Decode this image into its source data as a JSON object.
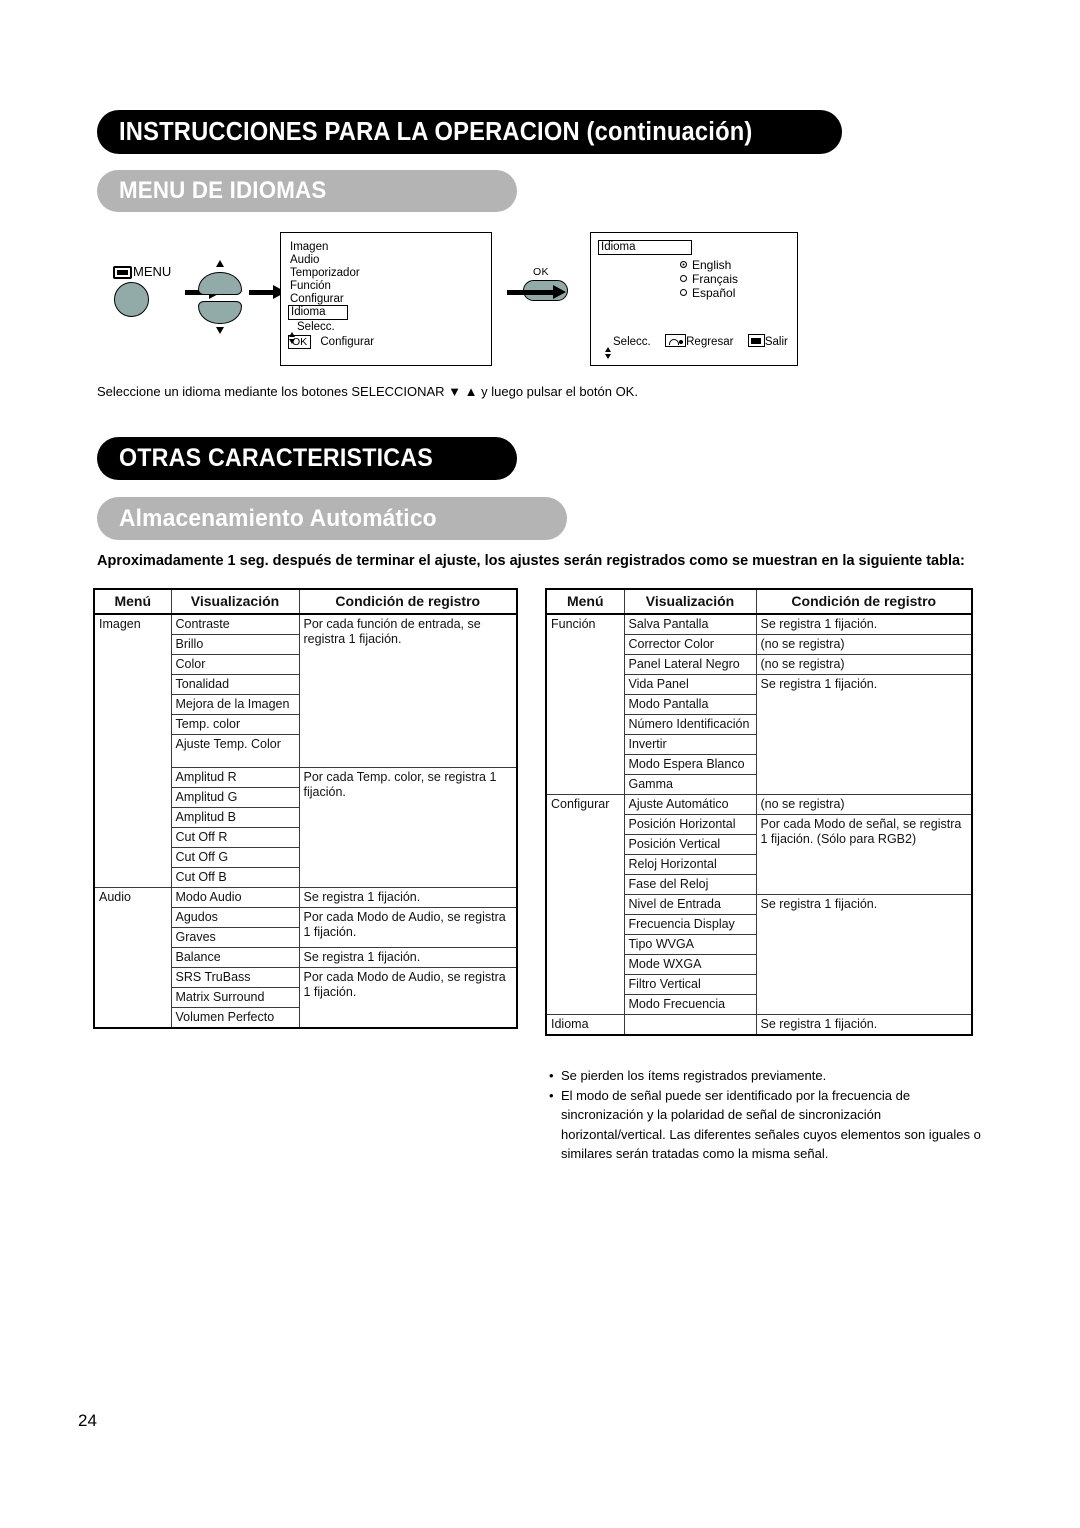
{
  "headings": {
    "main": "INSTRUCCIONES PARA LA OPERACION (continuación)",
    "language_menu": "MENU DE IDIOMAS",
    "other_features": "OTRAS CARACTERISTICAS",
    "auto_storage": "Almacenamiento Automático"
  },
  "diagram": {
    "menu_button_label": "MENU",
    "ok_button_label": "OK",
    "main_menu": {
      "items": [
        "Imagen",
        "Audio",
        "Temporizador",
        "Función",
        "Configurar"
      ],
      "selected_item": "Idioma",
      "hint_select": "Selecc.",
      "hint_ok_key": "OK",
      "hint_ok_action": "Configurar"
    },
    "language_menu": {
      "title": "Idioma",
      "options": [
        {
          "label": "English",
          "selected": true
        },
        {
          "label": "Français",
          "selected": false
        },
        {
          "label": "Español",
          "selected": false
        }
      ],
      "hint_select": "Selecc.",
      "hint_return": "Regresar",
      "hint_exit": "Salir"
    }
  },
  "caption_select": "Seleccione un idioma mediante los botones SELECCIONAR ▼ ▲ y luego pulsar el botón OK.",
  "intro_bold": "Aproximadamente 1 seg. después de terminar el ajuste, los ajustes serán registrados como se muestran en la siguiente tabla:",
  "table_headers": {
    "menu": "Menú",
    "display": "Visualización",
    "condition": "Condición de registro"
  },
  "table_left": {
    "rows": [
      {
        "menu": "Imagen",
        "menu_rowspan": 14,
        "display": "Contraste",
        "condition": "Por cada función de entrada, se registra 1 fijación.",
        "cond_rowspan": 7
      },
      {
        "display": "Brillo"
      },
      {
        "display": "Color"
      },
      {
        "display": "Tonalidad"
      },
      {
        "display": "Mejora de la Imagen"
      },
      {
        "display": "Temp. color"
      },
      {
        "display": "Ajuste Temp. Color"
      },
      {
        "display": "Amplitud R",
        "align": "right",
        "condition": "Por cada Temp. color, se registra 1 fijación.",
        "cond_rowspan": 6
      },
      {
        "display": "Amplitud G",
        "align": "right"
      },
      {
        "display": "Amplitud B",
        "align": "right"
      },
      {
        "display": "Cut Off R",
        "align": "right"
      },
      {
        "display": "Cut Off G",
        "align": "right"
      },
      {
        "display": "Cut Off B",
        "align": "right"
      },
      {
        "display": "Modo Audio",
        "menu": "Audio",
        "menu_rowspan": 7,
        "condition": "Se registra 1 fijación.",
        "cond_rowspan": 1
      },
      {
        "display": "Agudos",
        "condition": "Por cada Modo de Audio, se registra 1 fijación.",
        "cond_rowspan": 2
      },
      {
        "display": "Graves"
      },
      {
        "display": "Balance",
        "condition": "Se registra 1 fijación.",
        "cond_rowspan": 1
      },
      {
        "display": "SRS TruBass",
        "condition": "Por cada Modo de Audio, se registra 1 fijación.",
        "cond_rowspan": 3
      },
      {
        "display": "Matrix Surround"
      },
      {
        "display": "Volumen Perfecto"
      }
    ]
  },
  "table_right": {
    "rows": [
      {
        "menu": "Función",
        "display": "Salva Pantalla",
        "condition": "Se registra 1 fijación."
      },
      {
        "display": "Corrector Color",
        "condition": "(no se registra)"
      },
      {
        "display": "Panel Lateral Negro",
        "condition": "(no se registra)"
      },
      {
        "display": "Vida Panel",
        "condition": "Se registra 1 fijación."
      },
      {
        "display": "Modo Pantalla"
      },
      {
        "display": "Número Identificación"
      },
      {
        "display": "Invertir"
      },
      {
        "display": "Modo Espera Blanco"
      },
      {
        "display": "Gamma"
      },
      {
        "menu": "Configurar",
        "display": "Ajuste Automático",
        "condition": "(no se registra)"
      },
      {
        "display": "Posición Horizontal",
        "condition": "Por cada Modo de señal, se registra 1 fijación. (Sólo para RGB2)"
      },
      {
        "display": "Posición Vertical"
      },
      {
        "display": "Reloj Horizontal"
      },
      {
        "display": "Fase del Reloj"
      },
      {
        "display": "Nivel de Entrada",
        "condition": "Se registra 1 fijación."
      },
      {
        "display": "Frecuencia Display"
      },
      {
        "display": "Tipo WVGA"
      },
      {
        "display": "Mode WXGA"
      },
      {
        "display": "Filtro Vertical"
      },
      {
        "display": "Modo Frecuencia"
      },
      {
        "menu": "Idioma",
        "display": "",
        "condition": "Se registra 1 fijación."
      }
    ]
  },
  "notes": [
    "Se pierden los ítems registrados previamente.",
    "El modo de señal puede ser identificado por la frecuencia de sincronización y la polaridad de señal de sincronización horizontal/vertical. Las diferentes señales cuyos elementos son iguales o similares serán tratadas como la misma señal."
  ],
  "page_number": "24"
}
